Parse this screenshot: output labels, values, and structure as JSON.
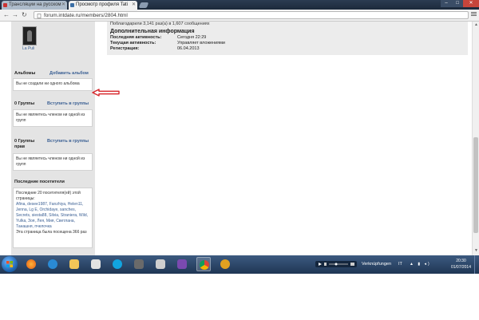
{
  "browser": {
    "tabs": [
      {
        "label": "Трансляции на русском",
        "active": false
      },
      {
        "label": "Просмотр профиля Tati",
        "active": true
      }
    ],
    "address": "forum.intdate.ru/members/2804.html"
  },
  "sidebar": {
    "user_name": "La Puli",
    "albums": {
      "title": "Альбомы",
      "action": "Добавить альбом",
      "empty": "Вы не создали ни одного альбома"
    },
    "groups": {
      "title": "0 Группы",
      "action": "Вступить в группы",
      "empty": "Вы не являетесь членом ни одной из групп"
    },
    "rights_groups": {
      "title": "0 Группы прав",
      "action": "Вступить в группы",
      "empty": "Вы не являетесь членом ни одной из групп"
    },
    "visitors": {
      "title": "Последние посетители",
      "intro": "Последние 20 посетителя(ей) этой страницы:",
      "names": "Afina, desee1987, Fanzhiya, Helen11, Jenna, Lg E, Orchidaye, sanches, Secrets, siesta88, Silvia, Straniera, Wild, Yulka, Зоя, Лея, Мия, Светлана, Танашня, пчелочка",
      "footer": "Эта страница была посещена 366 раз"
    }
  },
  "profile": {
    "thanks_line": "Поблагодарили 3,141 раз(а) в 1,607 сообщениях",
    "additional_title": "Дополнительная информация",
    "rows": [
      {
        "label": "Последняя активность:",
        "value": "Сегодня 22:29"
      },
      {
        "label": "Текущая активность:",
        "value": "Управляет вложениями"
      },
      {
        "label": "Регистрация:",
        "value": "06.04.2013"
      }
    ]
  },
  "taskbar": {
    "tray_label": "Verknüpfungen",
    "lang": "IT",
    "time": "20:30",
    "date": "01/07/2014"
  },
  "colors": {
    "link": "#3a5f93",
    "annotation_arrow": "#d6262b",
    "taskbar": "#2a4468"
  }
}
